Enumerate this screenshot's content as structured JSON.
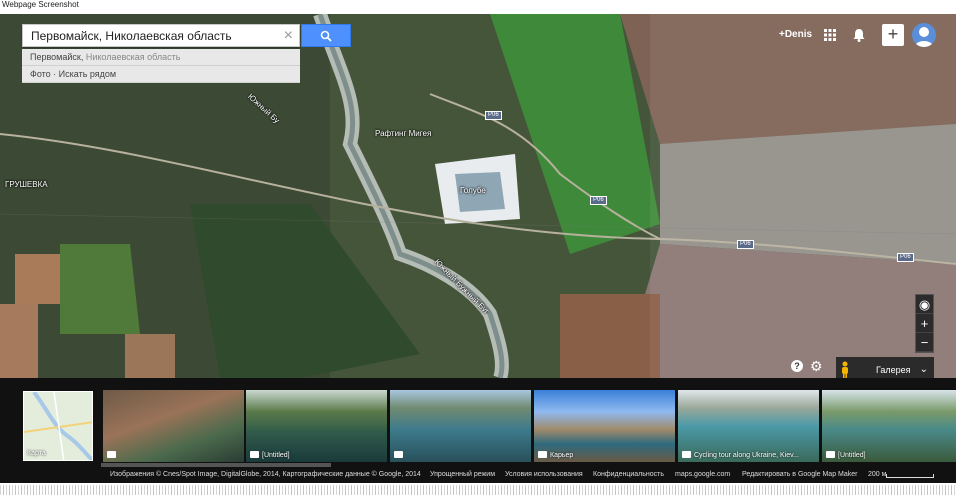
{
  "page_caption": "Webpage Screenshot",
  "search": {
    "value": "Первомайск, Николаевская область",
    "suggestion_main": "Первомайск,",
    "suggestion_rest": " Николаевская область",
    "nearby": "Фото · Искать рядом"
  },
  "topbar": {
    "user": "+Denis",
    "plus": "+"
  },
  "map_labels": {
    "place": "Рафтинг Мигея",
    "lake": "Голубе",
    "village": "ГРУШЕВКА",
    "river1": "Южный Бу",
    "river2": "Южный Бужный Буг",
    "road": "Р06"
  },
  "controls": {
    "help": "?",
    "zoom_in": "+",
    "zoom_out": "−",
    "gallery": "Галерея"
  },
  "strip": {
    "mini_map": "Карта",
    "thumbs": [
      "",
      "[Untitled]",
      "",
      "Карьер",
      "Cycling tour along Ukraine, Kiev...",
      "[Untitled]"
    ]
  },
  "footer": {
    "attribution": "Изображения © Cnes/Spot Image, DigitalGlobe, 2014, Картографические данные © Google, 2014",
    "lite": "Упрощенный режим",
    "terms": "Условия использования",
    "privacy": "Конфиденциальность",
    "domain": "maps.google.com",
    "mapmaker": "Редактировать в Google Map Maker",
    "scale": "200 м"
  }
}
